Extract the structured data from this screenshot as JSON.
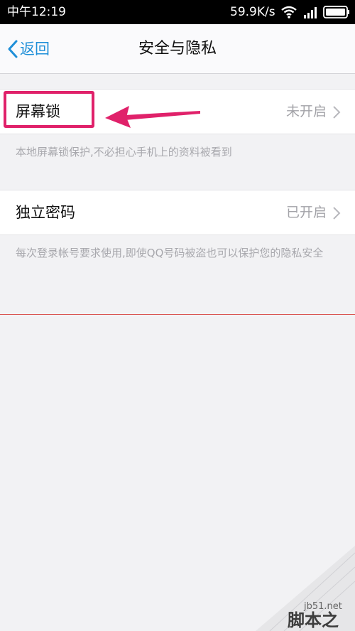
{
  "status_bar": {
    "time": "中午12:19",
    "network_speed": "59.9K/s"
  },
  "header": {
    "back_label": "返回",
    "title": "安全与隐私"
  },
  "settings": [
    {
      "label": "屏幕锁",
      "value": "未开启",
      "description": "本地屏幕锁保护,不必担心手机上的资料被看到"
    },
    {
      "label": "独立密码",
      "value": "已开启",
      "description": "每次登录帐号要求使用,即使QQ号码被盗也可以保护您的隐私安全"
    }
  ],
  "annotation": {
    "highlight_color": "#e0216a",
    "target": "屏幕锁"
  },
  "watermark": {
    "small": "jb51.net",
    "big": "脚本之家"
  },
  "colors": {
    "accent": "#1f8fd8",
    "background": "#f2f2f4",
    "secondary_text": "#a3a3a8"
  },
  "icons": {
    "wifi": "wifi-icon",
    "signal": "signal-icon",
    "battery": "battery-icon",
    "back": "chevron-left-icon",
    "row_arrow": "chevron-right-icon"
  }
}
